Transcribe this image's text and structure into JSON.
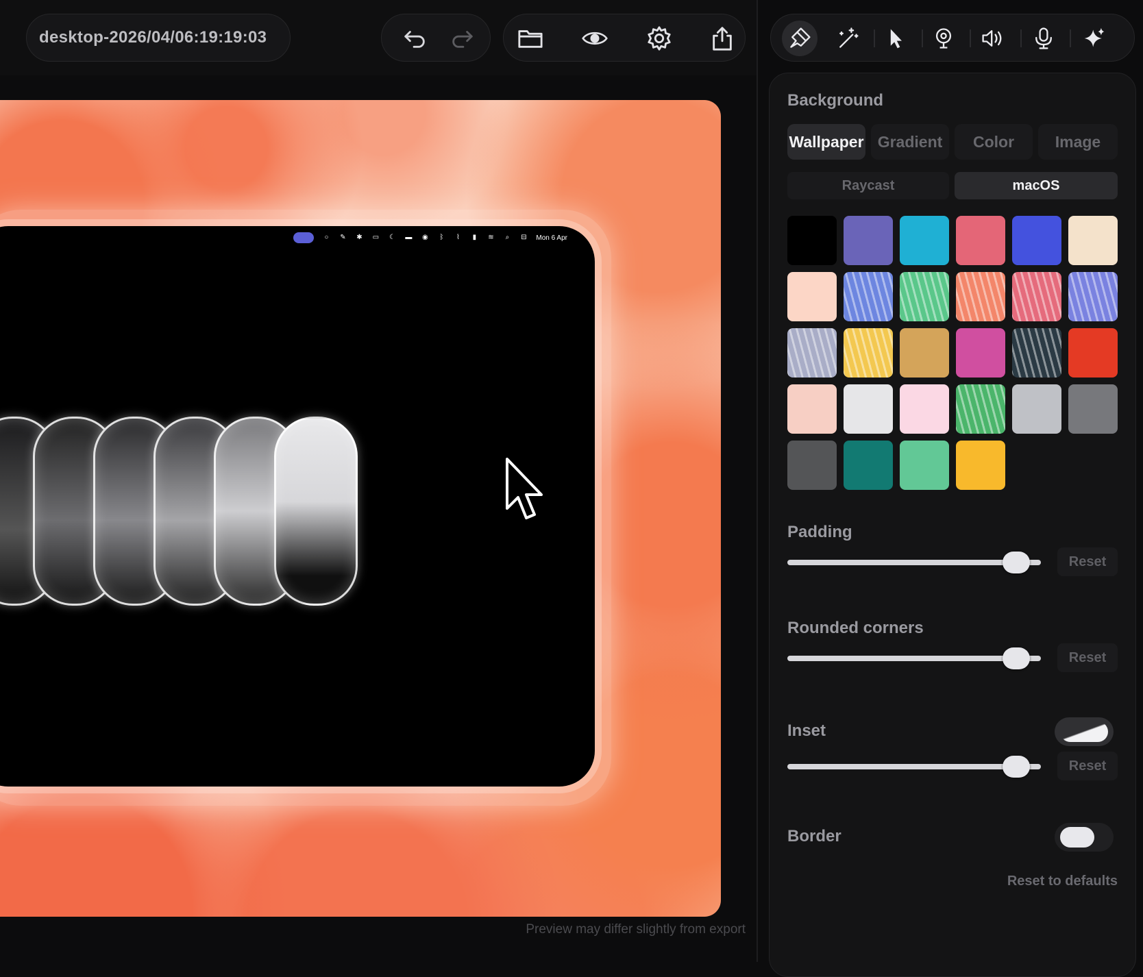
{
  "toolbar": {
    "file_title": "desktop-2026/04/06:19:19:03",
    "icons": [
      "undo-icon",
      "redo-icon",
      "folder-icon",
      "eye-icon",
      "gear-icon",
      "share-icon"
    ]
  },
  "side_tools": {
    "icons": [
      "brush-icon",
      "magic-wand-icon",
      "pointer-icon",
      "webcam-icon",
      "speaker-icon",
      "microphone-icon",
      "sparkle-icon"
    ],
    "active": "brush-icon"
  },
  "preview": {
    "menubar_date": "Mon 6 Apr",
    "note": "Preview may differ slightly from export"
  },
  "panel": {
    "background_title": "Background",
    "bg_tabs": [
      {
        "label": "Wallpaper",
        "active": true
      },
      {
        "label": "Gradient",
        "active": false
      },
      {
        "label": "Color",
        "active": false
      },
      {
        "label": "Image",
        "active": false
      }
    ],
    "source_tabs": [
      {
        "label": "Raycast",
        "active": false
      },
      {
        "label": "macOS",
        "active": true
      }
    ],
    "swatch_colors": [
      "#000000",
      "#6a64b8",
      "#1fb0d4",
      "#e46677",
      "#4452de",
      "#f4e2cb",
      "#fcd6c6",
      "#6d86e0",
      "#5ac78a",
      "#f3866a",
      "#e56b7c",
      "#7a82e0",
      "#a9adc7",
      "#f3c850",
      "#d4a45a",
      "#d04fa0",
      "#2b3a44",
      "#e43a24",
      "#f7cfc4",
      "#e6e6e8",
      "#fbd8e4",
      "#4bb56b",
      "#bfc1c6",
      "#77787c",
      "#545557",
      "#127a72",
      "#62c896",
      "#f8b92c"
    ],
    "padding_title": "Padding",
    "padding_value": 0.95,
    "rounded_title": "Rounded corners",
    "rounded_value": 0.95,
    "inset_title": "Inset",
    "inset_enabled": true,
    "inset_value": 0.95,
    "border_title": "Border",
    "border_enabled": false,
    "reset_label": "Reset",
    "reset_all_label": "Reset to defaults"
  }
}
